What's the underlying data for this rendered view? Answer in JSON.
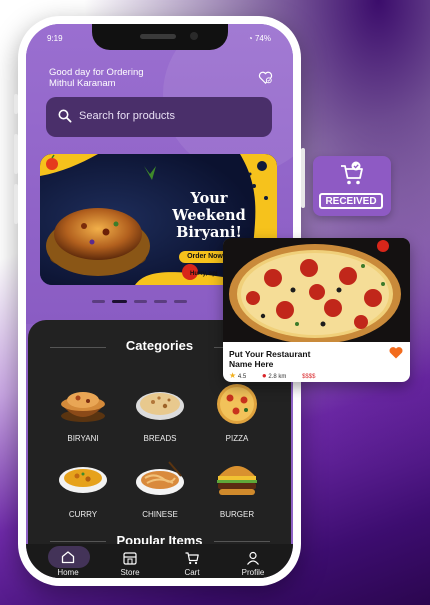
{
  "status": {
    "time": "9:19",
    "battery": "74%"
  },
  "header": {
    "greeting": "Good day for Ordering",
    "user_name": "Mithul Karanam"
  },
  "search": {
    "placeholder": "Search for products"
  },
  "banner": {
    "title_line1": "Your",
    "title_line2": "Weekend",
    "title_line3": "Biryani!",
    "cta": "Order Now",
    "tagline": "Hurry, spi"
  },
  "carousel": {
    "total": 5,
    "active_index": 1
  },
  "categories": {
    "title": "Categories",
    "items": [
      {
        "label": "BIRYANI"
      },
      {
        "label": "BREADS"
      },
      {
        "label": "PIZZA"
      },
      {
        "label": "CURRY"
      },
      {
        "label": "CHINESE"
      },
      {
        "label": "BURGER"
      }
    ]
  },
  "popular": {
    "title": "Popular Items"
  },
  "nav": {
    "items": [
      {
        "label": "Home",
        "icon": "home-icon",
        "active": true
      },
      {
        "label": "Store",
        "icon": "store-icon",
        "active": false
      },
      {
        "label": "Cart",
        "icon": "cart-icon",
        "active": false
      },
      {
        "label": "Profile",
        "icon": "profile-icon",
        "active": false
      }
    ]
  },
  "badge": {
    "label": "RECEIVED",
    "icon": "cart-check-icon"
  },
  "restaurant_card": {
    "name_line1": "Put Your Restaurant",
    "name_line2": "Name Here",
    "rating": "4.5",
    "distance": "2.8 km",
    "price": "$$$$"
  },
  "colors": {
    "accent": "#8e5ac4",
    "top_bg": "#9a6fd0",
    "dark_bg": "#222222",
    "heart": "#f26b1d"
  }
}
